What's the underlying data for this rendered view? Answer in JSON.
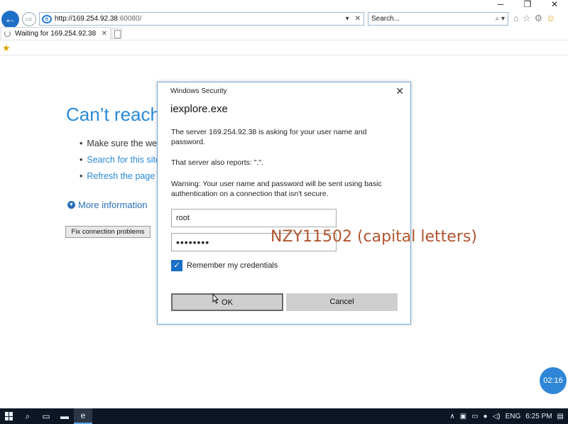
{
  "window_controls": {
    "minimize": "─",
    "restore": "❐",
    "close": "✕"
  },
  "nav": {
    "back_icon": "←",
    "forward_icon": "⇨"
  },
  "address": {
    "host": "http://169.254.92.38",
    "port": ":60080/",
    "dropdown": "▾",
    "stop": "✕"
  },
  "search": {
    "placeholder": "Search...",
    "button": "⌕ ▾"
  },
  "tab": {
    "title": "Waiting for 169.254.92.38",
    "close": "✕"
  },
  "error_page": {
    "title": "Can’t reach this page",
    "items": [
      {
        "text": "Make sure the web address is correct",
        "type": "plain"
      },
      {
        "text": "Search for this site on Bing",
        "type": "link"
      },
      {
        "text": "Refresh the page",
        "type": "link"
      }
    ],
    "more_info": "More information",
    "fix_button": "Fix connection problems"
  },
  "dialog": {
    "caption": "Windows Security",
    "close": "✕",
    "app": "iexplore.exe",
    "line1": "The server 169.254.92.38 is asking for your user name and password.",
    "line2": "That server also reports: \".\".",
    "line3": "Warning: Your user name and password will be sent using basic authentication on a connection that isn't secure.",
    "username": "root",
    "password_mask": "••••••••",
    "remember_label": "Remember my credentials",
    "remember_checked": true,
    "ok_label": "OK",
    "cancel_label": "Cancel"
  },
  "overlay_text": "NZY11502 (capital letters)",
  "timer": "02:16",
  "taskbar": {
    "tray_lang": "ENG",
    "time": "6:25 PM"
  },
  "colors": {
    "link": "#2a8ad6",
    "dialog_border": "#6ea6d8",
    "overlay": "#b0552e",
    "taskbar": "#0d1624"
  }
}
